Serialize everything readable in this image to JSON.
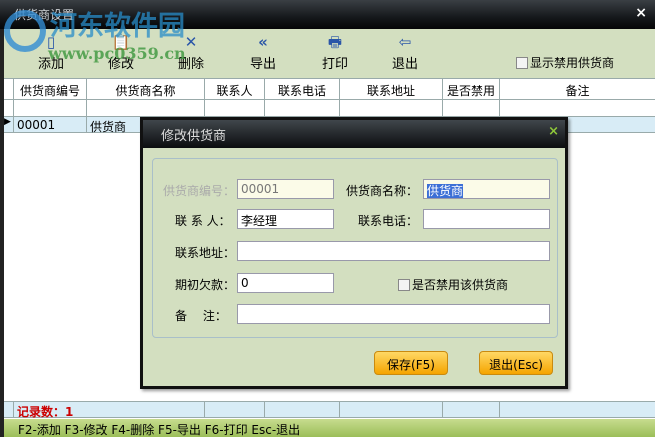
{
  "window": {
    "title": "供货商设置",
    "close": "×"
  },
  "watermark": {
    "name": "河东软件园",
    "url": "www.pc0359.cn"
  },
  "toolbar": {
    "buttons": [
      {
        "label": "添加",
        "icon": "add-icon"
      },
      {
        "label": "修改",
        "icon": "edit-icon"
      },
      {
        "label": "删除",
        "icon": "delete-icon"
      },
      {
        "label": "导出",
        "icon": "export-icon"
      },
      {
        "label": "打印",
        "icon": "print-icon"
      },
      {
        "label": "退出",
        "icon": "exit-icon"
      }
    ],
    "show_disabled": "显示禁用供货商"
  },
  "table": {
    "headers": [
      "供货商编号",
      "供货商名称",
      "联系人",
      "联系电话",
      "联系地址",
      "是否禁用",
      "备注"
    ],
    "rows": [
      {
        "id": "00001",
        "name": "供货商"
      }
    ],
    "record_count": "记录数：1"
  },
  "status": "F2-添加 F3-修改 F4-删除 F5-导出 F6-打印 Esc-退出",
  "dialog": {
    "title": "修改供货商",
    "close": "×",
    "fields": {
      "id_label": "供货商编号：",
      "id": "00001",
      "name_label": "供货商名称：",
      "name": "供货商",
      "contact_label": "联 系 人：",
      "contact": "李经理",
      "phone_label": "联系电话：",
      "phone": "",
      "address_label": "联系地址：",
      "address": "",
      "debt_label": "期初欠款：",
      "debt": "0",
      "disabled_label": "是否禁用该供货商",
      "note_label": "备　 注：",
      "note": ""
    },
    "save": "保存(F5)",
    "exit": "退出(Esc)"
  }
}
